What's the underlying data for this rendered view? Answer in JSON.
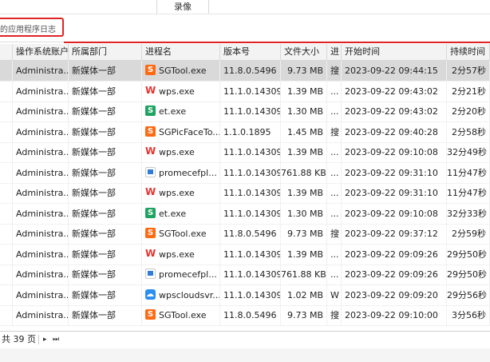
{
  "header": {
    "tab_record": "录像"
  },
  "search": {
    "value": "的应用程序日志"
  },
  "table": {
    "columns": [
      "操作系统账户",
      "所属部门",
      "进程名",
      "版本号",
      "文件大小",
      "进",
      "开始时间",
      "持续时间"
    ],
    "rows": [
      {
        "account": "Administra...",
        "dept": "新媒体一部",
        "icon": "sgtool-icon",
        "proc": "SGTool.exe",
        "ver": "11.8.0.5496",
        "size": "9.73 MB",
        "flag": "搜",
        "start": "2023-09-22 09:44:15",
        "dur": "2分57秒",
        "selected": true
      },
      {
        "account": "Administra...",
        "dept": "新媒体一部",
        "icon": "wps-icon",
        "proc": "wps.exe",
        "ver": "11.1.0.14309",
        "size": "1.39 MB",
        "flag": "...",
        "start": "2023-09-22 09:43:02",
        "dur": "2分21秒"
      },
      {
        "account": "Administra...",
        "dept": "新媒体一部",
        "icon": "et-icon",
        "proc": "et.exe",
        "ver": "11.1.0.14309",
        "size": "1.30 MB",
        "flag": "...",
        "start": "2023-09-22 09:43:02",
        "dur": "2分20秒"
      },
      {
        "account": "Administra...",
        "dept": "新媒体一部",
        "icon": "sgtool-icon",
        "proc": "SGPicFaceTo...",
        "ver": "1.1.0.1895",
        "size": "1.45 MB",
        "flag": "搜",
        "start": "2023-09-22 09:40:28",
        "dur": "2分58秒"
      },
      {
        "account": "Administra...",
        "dept": "新媒体一部",
        "icon": "wps-icon",
        "proc": "wps.exe",
        "ver": "11.1.0.14309",
        "size": "1.39 MB",
        "flag": "...",
        "start": "2023-09-22 09:10:08",
        "dur": "32分49秒"
      },
      {
        "account": "Administra...",
        "dept": "新媒体一部",
        "icon": "promecef-icon",
        "proc": "promecefpl...",
        "ver": "11.1.0.14309",
        "size": "761.88 KB",
        "flag": "...",
        "start": "2023-09-22 09:31:10",
        "dur": "11分47秒"
      },
      {
        "account": "Administra...",
        "dept": "新媒体一部",
        "icon": "wps-icon",
        "proc": "wps.exe",
        "ver": "11.1.0.14309",
        "size": "1.39 MB",
        "flag": "...",
        "start": "2023-09-22 09:31:10",
        "dur": "11分47秒"
      },
      {
        "account": "Administra...",
        "dept": "新媒体一部",
        "icon": "et-icon",
        "proc": "et.exe",
        "ver": "11.1.0.14309",
        "size": "1.30 MB",
        "flag": "...",
        "start": "2023-09-22 09:10:08",
        "dur": "32分33秒"
      },
      {
        "account": "Administra...",
        "dept": "新媒体一部",
        "icon": "sgtool-icon",
        "proc": "SGTool.exe",
        "ver": "11.8.0.5496",
        "size": "9.73 MB",
        "flag": "搜",
        "start": "2023-09-22 09:37:12",
        "dur": "2分59秒"
      },
      {
        "account": "Administra...",
        "dept": "新媒体一部",
        "icon": "wps-icon",
        "proc": "wps.exe",
        "ver": "11.1.0.14309",
        "size": "1.39 MB",
        "flag": "...",
        "start": "2023-09-22 09:09:26",
        "dur": "29分50秒"
      },
      {
        "account": "Administra...",
        "dept": "新媒体一部",
        "icon": "promecef-icon",
        "proc": "promecefpl...",
        "ver": "11.1.0.14309",
        "size": "761.88 KB",
        "flag": "...",
        "start": "2023-09-22 09:09:26",
        "dur": "29分50秒"
      },
      {
        "account": "Administra...",
        "dept": "新媒体一部",
        "icon": "cloud-icon",
        "proc": "wpscloudsvr...",
        "ver": "11.1.0.14309",
        "size": "1.02 MB",
        "flag": "W",
        "start": "2023-09-22 09:09:20",
        "dur": "29分56秒"
      },
      {
        "account": "Administra...",
        "dept": "新媒体一部",
        "icon": "sgtool-icon",
        "proc": "SGTool.exe",
        "ver": "11.8.0.5496",
        "size": "9.73 MB",
        "flag": "搜",
        "start": "2023-09-22 09:10:00",
        "dur": "3分56秒"
      }
    ]
  },
  "footer": {
    "pages": "共 39 页",
    "next": "▸",
    "last": "⏭"
  },
  "colors": {
    "highlight_red": "#e02424",
    "selected_row": "#d9d9d9"
  }
}
